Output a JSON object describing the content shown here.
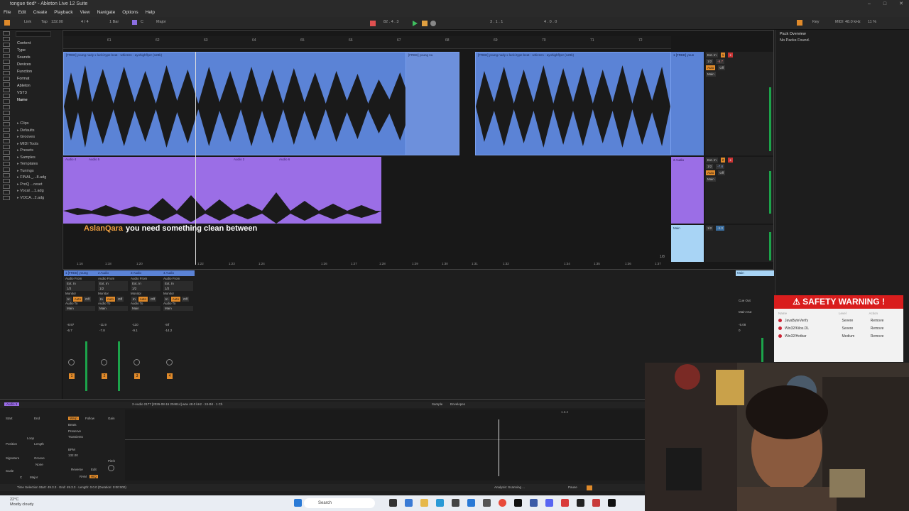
{
  "window": {
    "title": "tongue tied* - Ableton Live 12 Suite",
    "controls": [
      "–",
      "□",
      "✕"
    ]
  },
  "menu": [
    "File",
    "Edit",
    "Create",
    "Playback",
    "View",
    "Navigate",
    "Options",
    "Help"
  ],
  "toolbar": {
    "link": "Link",
    "tap": "Tap",
    "tempo": "132.00",
    "time_sig": "4 / 4",
    "metro": "1 Bar",
    "key": "C",
    "scale": "Major",
    "position": "82 . 4 . 3",
    "loop_start": "3 . 1 . 1",
    "loop_len": "4 . 0 . 0",
    "key_label": "Key",
    "midi_label": "MIDI",
    "sample_rate": "48.0 kHz",
    "cpu": "11 %"
  },
  "browser": {
    "categories": [
      "Content",
      "Type",
      "Sounds",
      "Devices",
      "Function",
      "Format",
      "Ableton",
      "VST3",
      "Name"
    ],
    "files": [
      "Clips",
      "Defaults",
      "Grooves",
      "MIDI Tools",
      "Presets",
      "Samples",
      "Templates",
      "Tunings",
      "FINAL_...8.adg",
      "ProQ ...reset",
      "Vocal ...1.adg",
      "VOCA...2.adg"
    ]
  },
  "ruler": [
    "61",
    "62",
    "63",
    "64",
    "65",
    "66",
    "67",
    "68",
    "69",
    "70",
    "71",
    "72"
  ],
  "timeline_bottom": [
    "1:16",
    "1:18",
    "1:20",
    "1:22",
    "1:23",
    "1:24",
    "1:26",
    "1:27",
    "1:28",
    "1:29",
    "1:30",
    "1:31",
    "1:32",
    "1:34",
    "1:35",
    "1:36",
    "1:37"
  ],
  "clips": {
    "blue_1": "[FREE] young nudy x lucki type beat - whizzen - ayohighflyer (128k)",
    "blue_2": "[FREE] young nu",
    "blue_3": "[FREE] young nudy x lucki type beat - whizzen - ayohighflyer (128k)",
    "purple_1": "Audio 4",
    "purple_2": "Audio 5",
    "purple_3": "Audio 2",
    "purple_4": "Audio 6"
  },
  "tracks": {
    "t1_name": "1 [FREE] youn",
    "t2_name": "2 Audio",
    "main_name": "Main",
    "ext_in": "Ext. In",
    "ch": "1/2",
    "auto": "Auto",
    "off": "Off",
    "main_out": "Main",
    "t1_vol": "-6.7",
    "t2_vol": "-7.8",
    "main_vol": "-5.0",
    "quantize": "1/8"
  },
  "subtitle": {
    "name": "AslanQara",
    "message": "you need something clean between"
  },
  "mixer": {
    "channels": [
      {
        "name": "1 [FREE] young",
        "num": "1",
        "peak": "-8.97",
        "vol": "-6.7"
      },
      {
        "name": "2 Audio",
        "num": "2",
        "peak": "-11.9",
        "vol": "-7.8"
      },
      {
        "name": "3 Audio",
        "num": "3",
        "peak": "-110",
        "vol": "-9.1"
      },
      {
        "name": "4 Audio",
        "num": "4",
        "peak": "-inf",
        "vol": "-14.2"
      }
    ],
    "audio_from": "Audio From",
    "ext_in": "Ext. In",
    "ch": "1/2",
    "monitor": "Monitor",
    "in": "In",
    "auto": "Auto",
    "off": "Off",
    "audio_to": "Audio To",
    "main": "Main",
    "main_cue": "Cue Out",
    "main_out": "Main Out",
    "main_peak": "-5.08",
    "main_vol": "0"
  },
  "pack": {
    "title": "Pack Overview",
    "empty": "No Packs Found."
  },
  "warning": {
    "title": "⚠ SAFETY WARNING !",
    "cols": [
      "Name",
      "Level",
      "Action"
    ],
    "rows": [
      {
        "name": "JavaByteVerify",
        "level": "Severe",
        "action": "Remove"
      },
      {
        "name": "Win32/Kilos.DL",
        "level": "Severe",
        "action": "Remove"
      },
      {
        "name": "Win32/Hotbar",
        "level": "Medium",
        "action": "Remove"
      }
    ]
  },
  "detail": {
    "clip_name": "Audio 3",
    "file_info": "2-Audio 2177 [2026-08-16 204614].wav 48.0 kHz · 24-Bit · 1 Ch",
    "sample_tab": "Sample",
    "env_tab": "Envelopes",
    "start": "Start",
    "end": "End",
    "loop": "Loop",
    "position": "Position",
    "length": "Length",
    "signature": "Signature",
    "groove": "Groove",
    "none": "None",
    "scale": "Scale",
    "warp": "Warp",
    "follow": "Follow",
    "beats": "Beats",
    "preserve": "Preserve",
    "transients": "Transients",
    "bpm": "BPM",
    "bpm_val": "132.00",
    "reverse": "Reverse",
    "edit": "Edit",
    "ram": "RAM",
    "hiq": "HiQ",
    "gain": "Gain",
    "pitch": "Pitch",
    "key": "C",
    "major": "Major",
    "marker": "1.3.4"
  },
  "status": {
    "selection": "Time Selection   Start: 49.3.3  ·  End: 49.3.3  ·  Length: 0.0.0  (Duration: 0:00:000)",
    "analysis": "Analysis: Scanning ...",
    "pause": "Pause"
  },
  "taskbar": {
    "temp": "22°C",
    "weather": "Mostly cloudy",
    "search": "Search"
  },
  "colors": {
    "blue_clip": "#5b83d6",
    "purple_clip": "#9b6ee6",
    "accent": "#e08a2a",
    "warning_red": "#d91d1d"
  }
}
